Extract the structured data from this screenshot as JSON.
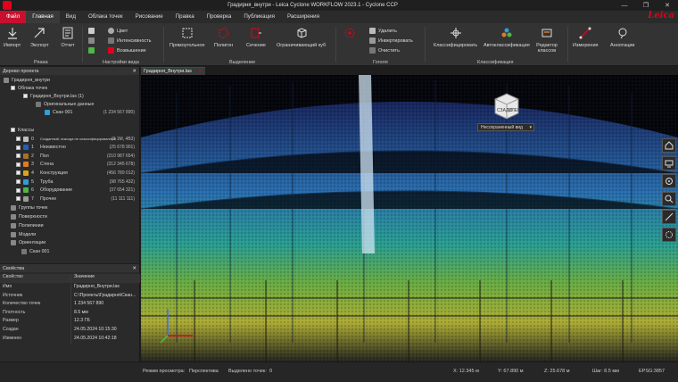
{
  "window": {
    "title": "Градирня_внутри - Leica Cyclone WORKFLOW 2023.1 - Cyclone CCP",
    "brand": "Leica",
    "controls": [
      "—",
      "❐",
      "✕"
    ]
  },
  "menu": [
    "Файл",
    "Главная",
    "Вид",
    "Облака точек",
    "Рисование",
    "Правка",
    "Проверка",
    "Публикация",
    "Расширения"
  ],
  "ribbon": {
    "import": "Импорт",
    "export": "Экспорт",
    "report": "Отчет",
    "group_share": "Ряааа",
    "color": "Цвет",
    "intensity": "Интенсивность",
    "elevation": "Возвышение",
    "group_view": "Настройки вида",
    "rect": "Прямоугольное",
    "polygon": "Полигон",
    "section": "Сечение",
    "limitbox": "Ограничивающий куб",
    "group_select": "Выделение",
    "delete": "Удалить",
    "invert": "Инвертировать",
    "clear": "Очистить",
    "group_tools": "Гоголя",
    "classify": "Классифицировать",
    "autoclass": "Автоклассификация",
    "classeditor": "Редактор классов",
    "group_class": "Классификация",
    "measure": "Измерения",
    "annot": "Аннотации"
  },
  "tree": {
    "title": "Дерево проекта",
    "project": "Градирня_внутри",
    "clouds": "Облака точек",
    "file": "Градирня_Внутри.las (1)",
    "original": "Оригинальные данные",
    "scan": "Скан 001",
    "scan_count": "(1 234 567 890)",
    "classes_title": "Классы",
    "classes": [
      {
        "num": "0",
        "name": "Созданный, никогда не классифицированный",
        "count": "(0 1M, 4B3)",
        "color": "#bdbdbd"
      },
      {
        "num": "1",
        "name": "Неизвестно",
        "count": "(25 678 901)",
        "color": "#1f5fbf"
      },
      {
        "num": "2",
        "name": "Пол",
        "count": "(210 987 654)",
        "color": "#a6722b"
      },
      {
        "num": "3",
        "name": "Стена",
        "count": "(312 345 678)",
        "color": "#e07b24"
      },
      {
        "num": "4",
        "name": "Конструкция",
        "count": "(456 789 012)",
        "color": "#d9a617"
      },
      {
        "num": "5",
        "name": "Труба",
        "count": "(98 765 432)",
        "color": "#2f9fd9"
      },
      {
        "num": "6",
        "name": "Оборудование",
        "count": "(37 654 321)",
        "color": "#4cb848"
      },
      {
        "num": "7",
        "name": "Прочее",
        "count": "(11 111 111)",
        "color": "#9a9a9a"
      }
    ],
    "groups": "Группы точек",
    "surfaces": "Поверхности",
    "polylines": "Полилинии",
    "models": "Модели",
    "orientations": "Ориентации",
    "orient_scan": "Скан 001"
  },
  "properties": {
    "title": "Свойства",
    "col_key": "Свойство",
    "col_val": "Значение",
    "rows": [
      {
        "k": "Имя",
        "v": "Градирня_Внутри.las"
      },
      {
        "k": "Источник",
        "v": "C:\\Проекты\\Градирня\\Скан..."
      },
      {
        "k": "Количество точек",
        "v": "1 234 567 890"
      },
      {
        "k": "Плотность",
        "v": "8.5 мм"
      },
      {
        "k": "Размер",
        "v": "12.3 ГБ"
      },
      {
        "k": "Создан",
        "v": "24.05.2024 10:15:30"
      },
      {
        "k": "Изменен",
        "v": "24.05.2024 10:42:18"
      }
    ]
  },
  "viewport": {
    "tab": "Градирня_Внутри.las",
    "viewcube_left": "СЗАДИ",
    "viewcube_right": "СЛЕВ",
    "view_mode": "Несохраненный вид"
  },
  "status": {
    "mode_label": "Режим просмотра:",
    "mode_value": "Перспектива",
    "selected_label": "Выделено точек:",
    "selected_value": "0",
    "x": "X:  12.345 м",
    "y": "Y:  67.890 м",
    "z": "Z:  25.678 м",
    "step": "Шаг:  8.5 мм",
    "epsg": "EPSG:3857"
  },
  "colors": {
    "accent": "#e3001b",
    "panel": "#2a2a2a",
    "ribbon": "#333333"
  }
}
